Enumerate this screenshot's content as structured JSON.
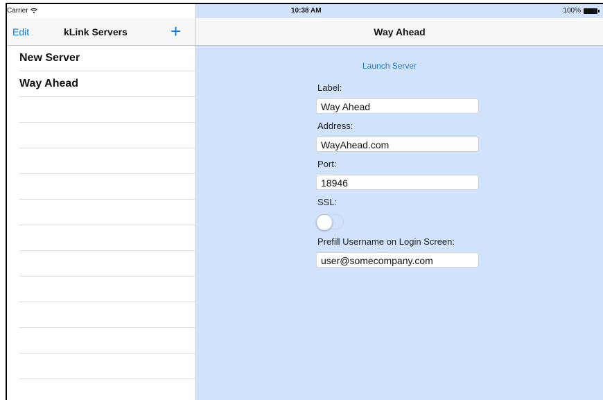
{
  "status_bar": {
    "carrier": "Carrier",
    "time": "10:38 AM",
    "battery": "100%"
  },
  "master": {
    "edit_label": "Edit",
    "title": "kLink Servers",
    "add_label": "+",
    "servers": [
      "New Server",
      "Way Ahead"
    ]
  },
  "detail": {
    "title": "Way Ahead",
    "launch_label": "Launch Server",
    "label_caption": "Label:",
    "label_value": "Way Ahead",
    "address_caption": "Address:",
    "address_value": "WayAhead.com",
    "port_caption": "Port:",
    "port_value": "18946",
    "ssl_caption": "SSL:",
    "ssl_on": false,
    "prefill_caption": "Prefill Username on Login Screen:",
    "prefill_value": "user@somecompany.com"
  },
  "colors": {
    "accent": "#007aff",
    "detail_background": "#d1e2fd"
  }
}
